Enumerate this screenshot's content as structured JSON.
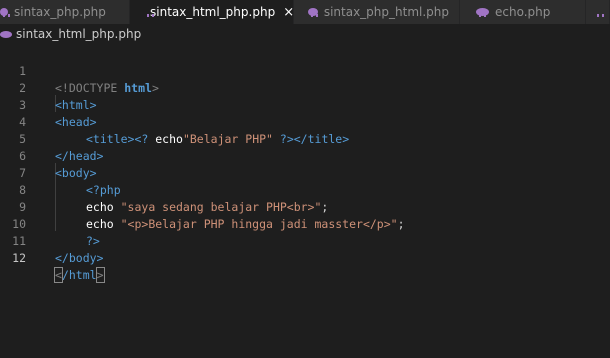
{
  "tabs": [
    {
      "label": "sintax_php.php",
      "active": false
    },
    {
      "label": "sintax_html_php.php",
      "active": true,
      "close": "×"
    },
    {
      "label": "sintax_php_html.php",
      "active": false
    },
    {
      "label": "echo.php",
      "active": false
    }
  ],
  "breadcrumb": {
    "file": "sintax_html_php.php"
  },
  "icons": {
    "file_icon": "php-elephant-icon",
    "close_icon": "close-icon"
  },
  "colors": {
    "tag": "#569cd6",
    "string": "#ce9178",
    "php_icon": "#a074c4"
  },
  "lines": [
    {
      "n": "1"
    },
    {
      "n": "2"
    },
    {
      "n": "3"
    },
    {
      "n": "4"
    },
    {
      "n": "5"
    },
    {
      "n": "6"
    },
    {
      "n": "7"
    },
    {
      "n": "8"
    },
    {
      "n": "9"
    },
    {
      "n": "10"
    },
    {
      "n": "11"
    },
    {
      "n": "12"
    }
  ],
  "code": {
    "l1_open": "<!DOCTYPE ",
    "l1_html": "html",
    "l1_close": ">",
    "l2": "<html>",
    "l3": "<head>",
    "l4_title_open": "<title>",
    "l4_php_open": "<?",
    "l4_echo": " echo",
    "l4_str": "\"Belajar PHP\"",
    "l4_php_close": " ?>",
    "l4_title_close": "</title>",
    "l5": "</head>",
    "l6": "<body>",
    "l7": "<?php",
    "l8_echo": "echo ",
    "l8_str": "\"saya sedang belajar PHP<br>\"",
    "l8_semi": ";",
    "l9_echo": "echo ",
    "l9_str": "\"<p>Belajar PHP hingga jadi masster</p>\"",
    "l9_semi": ";",
    "l10": "?>",
    "l11": "</body>",
    "l12_lt": "<",
    "l12_mid": "/html",
    "l12_gt": ">"
  }
}
